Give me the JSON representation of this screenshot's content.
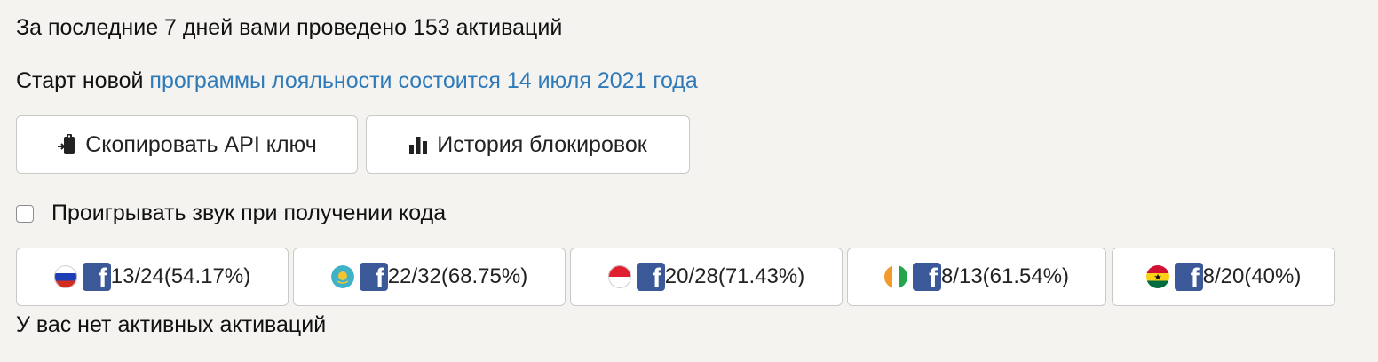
{
  "summary": {
    "activations_text": "За последние 7 дней вами проведено 153 активаций"
  },
  "loyalty": {
    "prefix": "Старт новой ",
    "link_text": "программы лояльности состоится 14 июля 2021 года"
  },
  "buttons": {
    "copy_api_key": "Скопировать API ключ",
    "block_history": "История блокировок"
  },
  "sound_option": {
    "label": "Проигрывать звук при получении кода",
    "checked": false
  },
  "stats": [
    {
      "country": "Russia",
      "service": "facebook",
      "text": "13/24(54.17%)"
    },
    {
      "country": "Kazakhstan",
      "service": "facebook",
      "text": "22/32(68.75%)"
    },
    {
      "country": "Indonesia",
      "service": "facebook",
      "text": "20/28(71.43%)"
    },
    {
      "country": "Ivory Coast",
      "service": "facebook",
      "text": "8/13(61.54%)"
    },
    {
      "country": "Ghana",
      "service": "facebook",
      "text": "8/20(40%)"
    }
  ],
  "active_status": "У вас нет активных активаций",
  "icons": {
    "copy": "clipboard-arrow-icon",
    "history": "bar-chart-icon",
    "service": "facebook-icon"
  },
  "colors": {
    "link": "#2f7ab9",
    "facebook": "#3b5998"
  }
}
